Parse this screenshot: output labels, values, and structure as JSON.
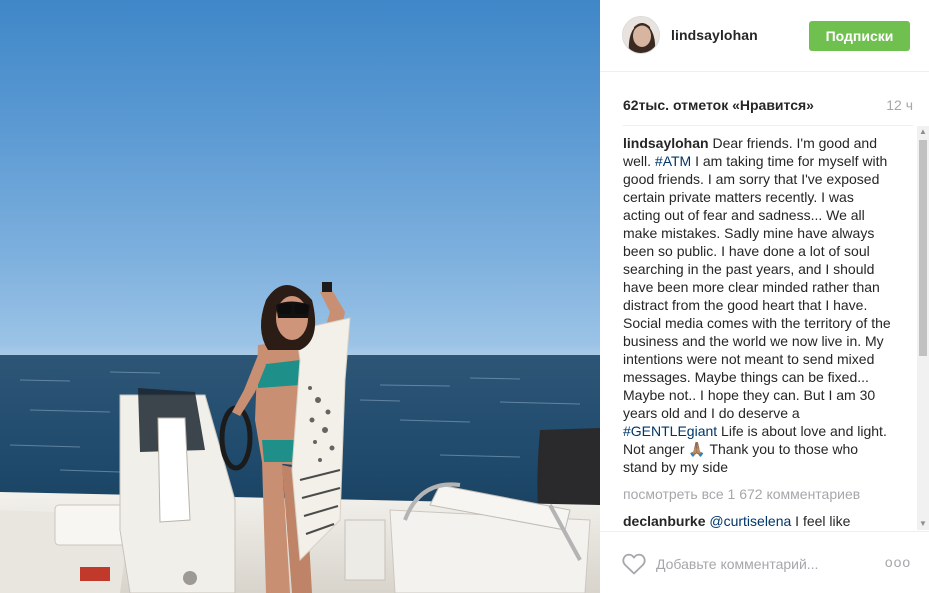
{
  "post": {
    "username": "lindsaylohan",
    "follow_label": "Подписки",
    "likes_text": "62тыс. отметок «Нравится»",
    "time_ago": "12 ч"
  },
  "caption": {
    "username": "lindsaylohan",
    "part1": " Dear friends. I'm good and well. ",
    "tag1": "#ATM",
    "part2": " I am taking time for myself with good friends. I am sorry that I've exposed certain private matters recently. I was acting out of fear and sadness... We all make mistakes. Sadly mine have always been so public. I have done a lot of soul searching in the past years, and I should have been more clear minded rather than distract from the good heart that I have. Social media comes with the territory of the business and the world we now live in. My intentions were not meant to send mixed messages. Maybe things can be fixed... Maybe not.. I hope they can. But I am 30 years old and I do deserve a ",
    "tag2": "#GENTLEgiant",
    "part3": " Life is about love and light. Not anger ",
    "emoji": "🙏🏽",
    "part4": " Thank you to those who stand by my side"
  },
  "comments": {
    "view_all": "посмотреть все 1 672 комментариев",
    "first": {
      "username": "declanburke",
      "mention": "@curtiselena",
      "text": " I feel like"
    }
  },
  "footer": {
    "comment_placeholder": "Добавьте комментарий...",
    "more_label": "ooo"
  },
  "colors": {
    "follow_button": "#70c050",
    "hashtag": "#003569",
    "muted_text": "#a5a7aa"
  },
  "icons": {
    "like": "heart-outline-icon",
    "more": "more-dots-icon",
    "scroll_up": "scroll-up-arrow-icon",
    "scroll_down": "scroll-down-arrow-icon"
  }
}
